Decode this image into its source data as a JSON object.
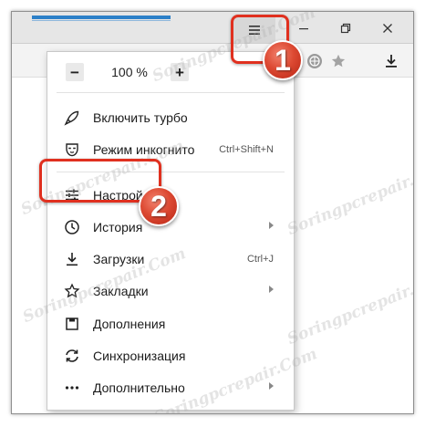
{
  "titlebar": {
    "menu_icon": "hamburger-icon",
    "minimize_icon": "minimize-icon",
    "restore_icon": "restore-icon",
    "close_icon": "close-icon"
  },
  "toolbar": {
    "icons": [
      "fullscreen-icon",
      "globe-icon",
      "star-icon",
      "download-icon"
    ]
  },
  "menu": {
    "zoom": {
      "minus": "−",
      "value": "100 %",
      "plus": "+"
    },
    "items": [
      {
        "label": "Включить турбо",
        "icon": "rocket-icon",
        "shortcut": "",
        "submenu": false
      },
      {
        "label": "Режим инкогнито",
        "icon": "incognito-mask-icon",
        "shortcut": "Ctrl+Shift+N",
        "submenu": false
      },
      {
        "label": "Настройки",
        "icon": "settings-sliders-icon",
        "shortcut": "",
        "submenu": false
      },
      {
        "label": "История",
        "icon": "history-clock-icon",
        "shortcut": "",
        "submenu": true
      },
      {
        "label": "Загрузки",
        "icon": "download-icon",
        "shortcut": "Ctrl+J",
        "submenu": false
      },
      {
        "label": "Закладки",
        "icon": "star-outline-icon",
        "shortcut": "",
        "submenu": true
      },
      {
        "label": "Дополнения",
        "icon": "addons-box-icon",
        "shortcut": "",
        "submenu": false
      },
      {
        "label": "Синхронизация",
        "icon": "sync-icon",
        "shortcut": "",
        "submenu": false
      },
      {
        "label": "Дополнительно",
        "icon": "more-dots-icon",
        "shortcut": "",
        "submenu": true
      }
    ]
  },
  "callouts": [
    {
      "number": "1",
      "target": "menu-button"
    },
    {
      "number": "2",
      "target": "menu-item-settings"
    }
  ],
  "watermark": "Soringpcrepair.Com",
  "colors": {
    "callout": "#e0301f",
    "tab_accent": "#2d80c8"
  }
}
